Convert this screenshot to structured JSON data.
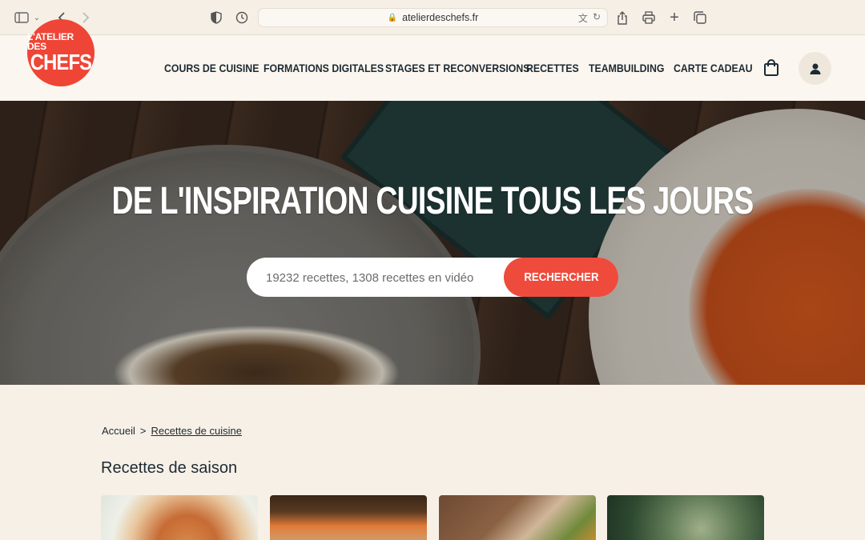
{
  "browser": {
    "url": "atelierdeschefs.fr"
  },
  "brand": {
    "logo_line1": "L'ATELIER DES",
    "logo_line2": "CHEFS",
    "accent_color": "#ef4536"
  },
  "nav": {
    "items": [
      {
        "label": "COURS DE CUISINE"
      },
      {
        "label": "FORMATIONS DIGITALES"
      },
      {
        "label": "STAGES ET RECONVERSIONS"
      },
      {
        "label": "RECETTES"
      },
      {
        "label": "TEAMBUILDING"
      },
      {
        "label": "CARTE CADEAU"
      }
    ],
    "icons": {
      "cart": "shopping-bag-icon",
      "account": "user-icon"
    }
  },
  "hero": {
    "title": "DE L'INSPIRATION CUISINE TOUS LES JOURS",
    "search_placeholder": "19232 recettes, 1308 recettes en vidéo",
    "search_button": "RECHERCHER"
  },
  "breadcrumb": {
    "home": "Accueil",
    "separator": ">",
    "current": "Recettes de cuisine"
  },
  "seasonal": {
    "title": "Recettes de saison",
    "cards": [
      {
        "image": "apple-tart"
      },
      {
        "image": "sweet-potato-dish"
      },
      {
        "image": "vegetable-platter"
      },
      {
        "image": "cabbage-broccoli"
      }
    ]
  }
}
